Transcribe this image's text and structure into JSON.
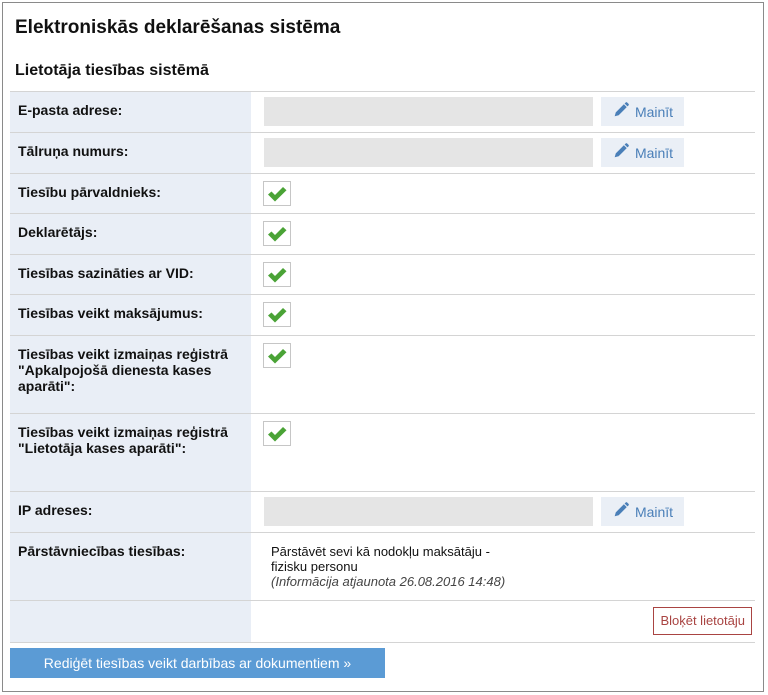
{
  "app": {
    "title": "Elektroniskās deklarēšanas sistēma"
  },
  "section": {
    "title": "Lietotāja tiesības sistēmā"
  },
  "fields": {
    "email": {
      "label": "E-pasta adrese:",
      "value": "",
      "edit_label": "Mainīt"
    },
    "phone": {
      "label": "Tālruņa numurs:",
      "value": "",
      "edit_label": "Mainīt"
    },
    "ip": {
      "label": "IP adreses:",
      "value": "",
      "edit_label": "Mainīt"
    }
  },
  "permissions": [
    {
      "label": "Tiesību pārvaldnieks:",
      "checked": true
    },
    {
      "label": "Deklarētājs:",
      "checked": true
    },
    {
      "label": "Tiesības sazināties ar VID:",
      "checked": true
    },
    {
      "label": "Tiesības veikt maksājumus:",
      "checked": true
    },
    {
      "label": "Tiesības veikt izmaiņas reģistrā \"Apkalpojošā dienesta kases aparāti\":",
      "checked": true
    },
    {
      "label": "Tiesības veikt izmaiņas reģistrā \"Lietotāja kases aparāti\":",
      "checked": true
    }
  ],
  "representation": {
    "label": "Pārstāvniecības tiesības:",
    "text_line1": "Pārstāvēt sevi kā nodokļu maksātāju -",
    "text_line2": "fizisku personu",
    "info": "(Informācija atjaunota 26.08.2016 14:48)"
  },
  "actions": {
    "block_user": "Bloķēt lietotāju",
    "edit_document_rights": "Rediģēt tiesības veikt darbības ar dokumentiem »"
  },
  "colors": {
    "label_bg": "#e9eef6",
    "check_green": "#4aa336",
    "link_blue": "#4a7fb8",
    "primary_button": "#5b9bd5",
    "danger": "#a94442"
  },
  "icons": {
    "edit": "pencil-icon",
    "checked": "checkmark-icon"
  }
}
